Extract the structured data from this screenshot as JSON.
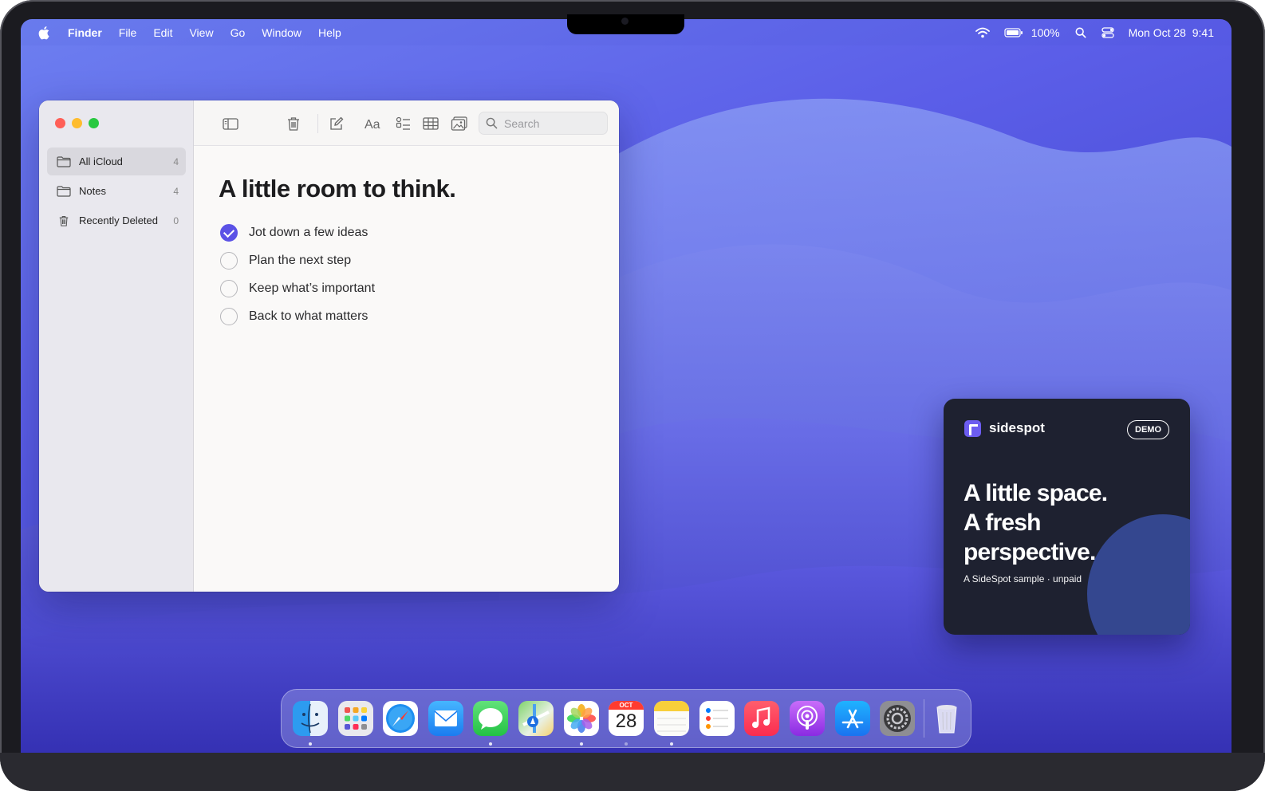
{
  "menubar": {
    "app_name": "Finder",
    "menus": [
      "File",
      "Edit",
      "View",
      "Go",
      "Window",
      "Help"
    ],
    "battery": "100%",
    "datetime": "Mon Oct 28  9:41"
  },
  "notes_window": {
    "sidebar": [
      {
        "label": "All iCloud",
        "count": "4",
        "icon": "folder-icon"
      },
      {
        "label": "Notes",
        "count": "4",
        "icon": "folder-icon"
      },
      {
        "label": "Recently Deleted",
        "count": "0",
        "icon": "trash-icon"
      }
    ],
    "search_placeholder": "Search",
    "note": {
      "title": "A little room to think.",
      "checklist": [
        {
          "text": "Jot down a few ideas",
          "done": true
        },
        {
          "text": "Plan the next step",
          "done": false
        },
        {
          "text": "Keep what’s important",
          "done": false
        },
        {
          "text": "Back to what matters",
          "done": false
        }
      ]
    }
  },
  "ad": {
    "brand": "sidespot",
    "badge": "DEMO",
    "headline_lines": [
      "A little space.",
      "A fresh",
      "perspective."
    ],
    "footer": "A SideSpot sample · unpaid"
  },
  "dock": {
    "calendar_month": "OCT",
    "calendar_day": "28",
    "apps": [
      "finder-icon",
      "launchpad-icon",
      "safari-icon",
      "mail-icon",
      "messages-icon",
      "maps-icon",
      "photos-icon",
      "calendar-icon",
      "notes-icon",
      "reminders-icon",
      "music-icon",
      "podcasts-icon",
      "app-store-icon",
      "system-settings-icon",
      "trash-icon"
    ]
  }
}
